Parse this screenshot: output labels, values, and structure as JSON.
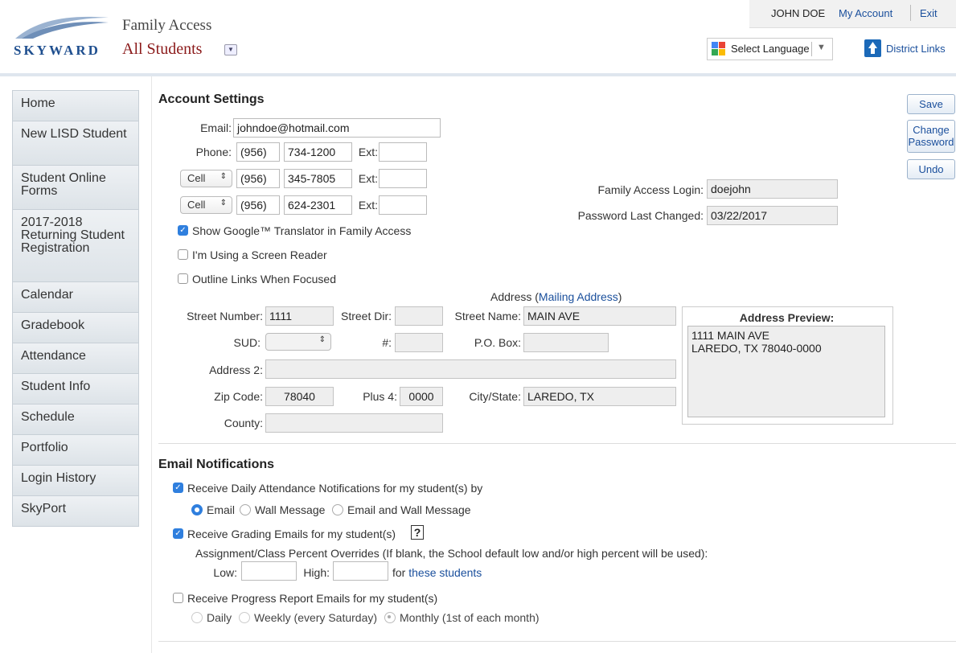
{
  "header": {
    "logo": "SKYWARD",
    "app_title": "Family Access",
    "student_selector": "All Students",
    "user_name": "JOHN DOE",
    "my_account": "My Account",
    "exit": "Exit",
    "select_language": "Select Language",
    "district_links": "District Links"
  },
  "sidebar": {
    "items": [
      {
        "label": "Home"
      },
      {
        "label": "New LISD Student"
      },
      {
        "label": "Student Online Forms"
      },
      {
        "label": "2017-2018 Returning Student Registration"
      },
      {
        "label": "Calendar"
      },
      {
        "label": "Gradebook"
      },
      {
        "label": "Attendance"
      },
      {
        "label": "Student Info"
      },
      {
        "label": "Schedule"
      },
      {
        "label": "Portfolio"
      },
      {
        "label": "Login History"
      },
      {
        "label": "SkyPort"
      }
    ]
  },
  "account": {
    "title": "Account Settings",
    "email_label": "Email:",
    "email": "johndoe@hotmail.com",
    "phone_label": "Phone:",
    "ext_label": "Ext:",
    "phones": [
      {
        "type": "",
        "area": "(956)",
        "number": "734-1200",
        "ext": ""
      },
      {
        "type": "Cell",
        "area": "(956)",
        "number": "345-7805",
        "ext": ""
      },
      {
        "type": "Cell",
        "area": "(956)",
        "number": "624-2301",
        "ext": ""
      }
    ],
    "login_label": "Family Access Login:",
    "login": "doejohn",
    "pwd_changed_label": "Password Last Changed:",
    "pwd_changed": "03/22/2017",
    "opt_translator": "Show Google™ Translator in Family Access",
    "opt_screen_reader": "I'm Using a Screen Reader",
    "opt_outline": "Outline Links When Focused"
  },
  "buttons": {
    "save": "Save",
    "change_password_1": "Change",
    "change_password_2": "Password",
    "undo": "Undo"
  },
  "address": {
    "heading": "Address (",
    "mailing_link": "Mailing Address",
    "heading_close": ")",
    "street_number_label": "Street Number:",
    "street_number": "1111",
    "street_dir_label": "Street Dir:",
    "street_dir": "",
    "street_name_label": "Street Name:",
    "street_name": "MAIN AVE",
    "sud_label": "SUD:",
    "num_label": "#:",
    "po_box_label": "P.O. Box:",
    "address2_label": "Address 2:",
    "zip_label": "Zip Code:",
    "zip": "78040",
    "plus4_label": "Plus 4:",
    "plus4": "0000",
    "city_label": "City/State:",
    "city": "LAREDO, TX",
    "county_label": "County:",
    "preview_title": "Address Preview:",
    "preview_line1": "1111 MAIN AVE",
    "preview_line2": "LAREDO, TX 78040-0000"
  },
  "email_notifications": {
    "title": "Email Notifications",
    "attendance": "Receive Daily Attendance Notifications for my student(s) by",
    "opt_email": "Email",
    "opt_wall": "Wall Message",
    "opt_both": "Email and Wall Message",
    "grading": "Receive Grading Emails for my student(s)",
    "help": "?",
    "overrides": "Assignment/Class Percent Overrides (If blank, the School default low and/or high percent will be used):",
    "low_label": "Low:",
    "high_label": "High:",
    "for_text": "for",
    "these_students": "these students",
    "progress": "Receive Progress Report Emails for my student(s)",
    "opt_daily": "Daily",
    "opt_weekly": "Weekly (every Saturday)",
    "opt_monthly": "Monthly (1st of each month)"
  }
}
